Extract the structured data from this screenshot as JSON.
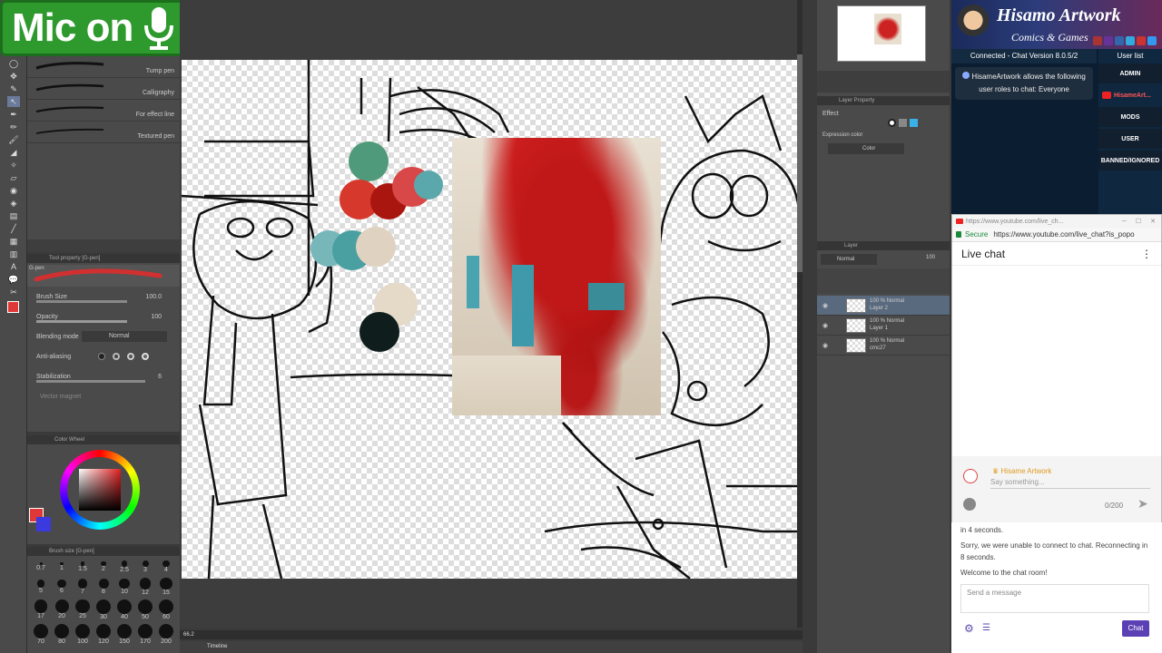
{
  "overlay": {
    "mic_label": "Mic on"
  },
  "brushes": [
    {
      "label": "Tump pen"
    },
    {
      "label": "Calligraphy"
    },
    {
      "label": "For effect line"
    },
    {
      "label": "Textured pen"
    }
  ],
  "tool_property": {
    "header": "Tool property [G-pen]",
    "brush_name": "G-pen",
    "size_label": "Brush Size",
    "size_value": "100.0",
    "opacity_label": "Opacity",
    "opacity_value": "100",
    "blending_label": "Blending mode",
    "blending_value": "Normal",
    "antialias_label": "Anti-aliasing",
    "stabilization_label": "Stabilization",
    "stabilization_value": "6",
    "vector_label": "Vector magnet"
  },
  "color_wheel": {
    "header": "Color Wheel",
    "main_color": "#e03838",
    "sub_color": "#3a3adf"
  },
  "brush_size": {
    "header": "Brush size [G-pen]",
    "sizes": [
      "0.7",
      "1",
      "1.5",
      "2",
      "2.5",
      "3",
      "4",
      "5",
      "6",
      "7",
      "8",
      "10",
      "12",
      "15",
      "17",
      "20",
      "25",
      "30",
      "40",
      "50",
      "60",
      "70",
      "80",
      "100",
      "120",
      "150",
      "170",
      "200"
    ]
  },
  "palette": {
    "circles": [
      "#4e9a7a",
      "#d6382c",
      "#a9150f",
      "#d84848",
      "#5aa8ab",
      "#77b7ba",
      "#4a9fa0",
      "#e0d2c0",
      "#e5d9c8",
      "#0f1d1d"
    ]
  },
  "layer_property": {
    "header": "Layer Property",
    "effect_label": "Effect",
    "expression_label": "Expression color",
    "expression_value": "Color"
  },
  "layers_panel": {
    "header": "Layer",
    "blend": "Normal",
    "opacity": "100",
    "layers": [
      {
        "line1": "100 % Normal",
        "line2": "Layer 2"
      },
      {
        "line1": "100 % Normal",
        "line2": "Layer 1"
      },
      {
        "line1": "100 % Normal",
        "line2": "cmc27"
      }
    ]
  },
  "bottom": {
    "timeline": "Timeline",
    "zoom": "66.2"
  },
  "stream_chat": {
    "banner_title": "Hisamo Artwork",
    "banner_subtitle": "Comics & Games",
    "connected": "Connected - Chat Version 8.0.5/2",
    "notice": "HisameArtwork allows the following user roles to chat: Everyone",
    "user_list_label": "User list",
    "roles": [
      "ADMIN",
      "HisameArt...",
      "MODS",
      "USER",
      "BANNED/IGNORED"
    ],
    "messages": [
      "in 4 seconds.",
      "Sorry, we were unable to connect to chat. Reconnecting in 8 seconds.",
      "Welcome to the chat room!"
    ],
    "input_placeholder": "Send a message",
    "chat_button": "Chat"
  },
  "browser": {
    "title": "https://www.youtube.com/live_ch...",
    "secure_label": "Secure",
    "url": "https://www.youtube.com/live_chat?is_popo",
    "heading": "Live chat",
    "author": "Hisame Artwork",
    "say_placeholder": "Say something...",
    "counter": "0/200"
  }
}
